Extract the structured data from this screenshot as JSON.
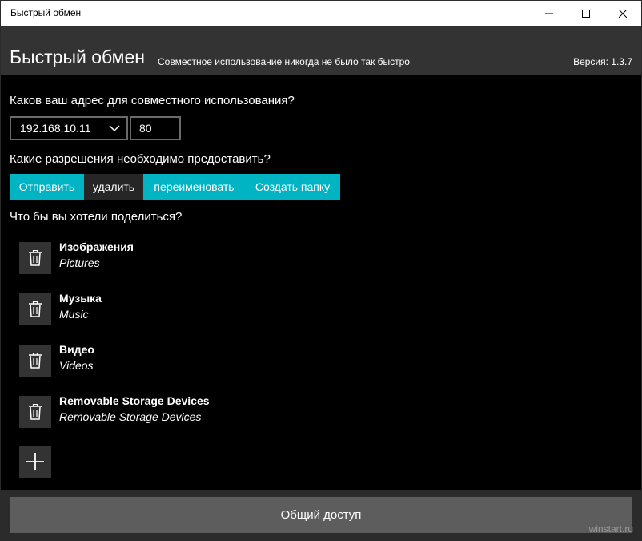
{
  "window": {
    "title": "Быстрый обмен"
  },
  "header": {
    "app_title": "Быстрый обмен",
    "subtitle": "Совместное использование никогда не было так быстро",
    "version": "Версия: 1.3.7"
  },
  "address": {
    "question": "Каков ваш адрес для совместного использования?",
    "ip": "192.168.10.11",
    "port": "80"
  },
  "permissions": {
    "question": "Какие разрешения необходимо предоставить?",
    "items": [
      {
        "label": "Отправить",
        "active": true
      },
      {
        "label": "удалить",
        "active": false
      },
      {
        "label": "переименовать",
        "active": true
      },
      {
        "label": "Создать папку",
        "active": true
      }
    ]
  },
  "shares": {
    "question": "Что бы вы хотели поделиться?",
    "items": [
      {
        "name": "Изображения",
        "path": "Pictures"
      },
      {
        "name": "Музыка",
        "path": "Music"
      },
      {
        "name": "Видео",
        "path": "Videos"
      },
      {
        "name": "Removable Storage Devices",
        "path": "Removable Storage Devices"
      }
    ]
  },
  "footer": {
    "share_button": "Общий доступ",
    "watermark": "winstart.ru"
  },
  "colors": {
    "accent": "#00b4c4",
    "header_bg": "#333333",
    "button_bg": "#5d5d5d"
  },
  "icons": {
    "trash": "trash-icon",
    "add": "plus-icon",
    "dropdown": "chevron-down-icon"
  }
}
